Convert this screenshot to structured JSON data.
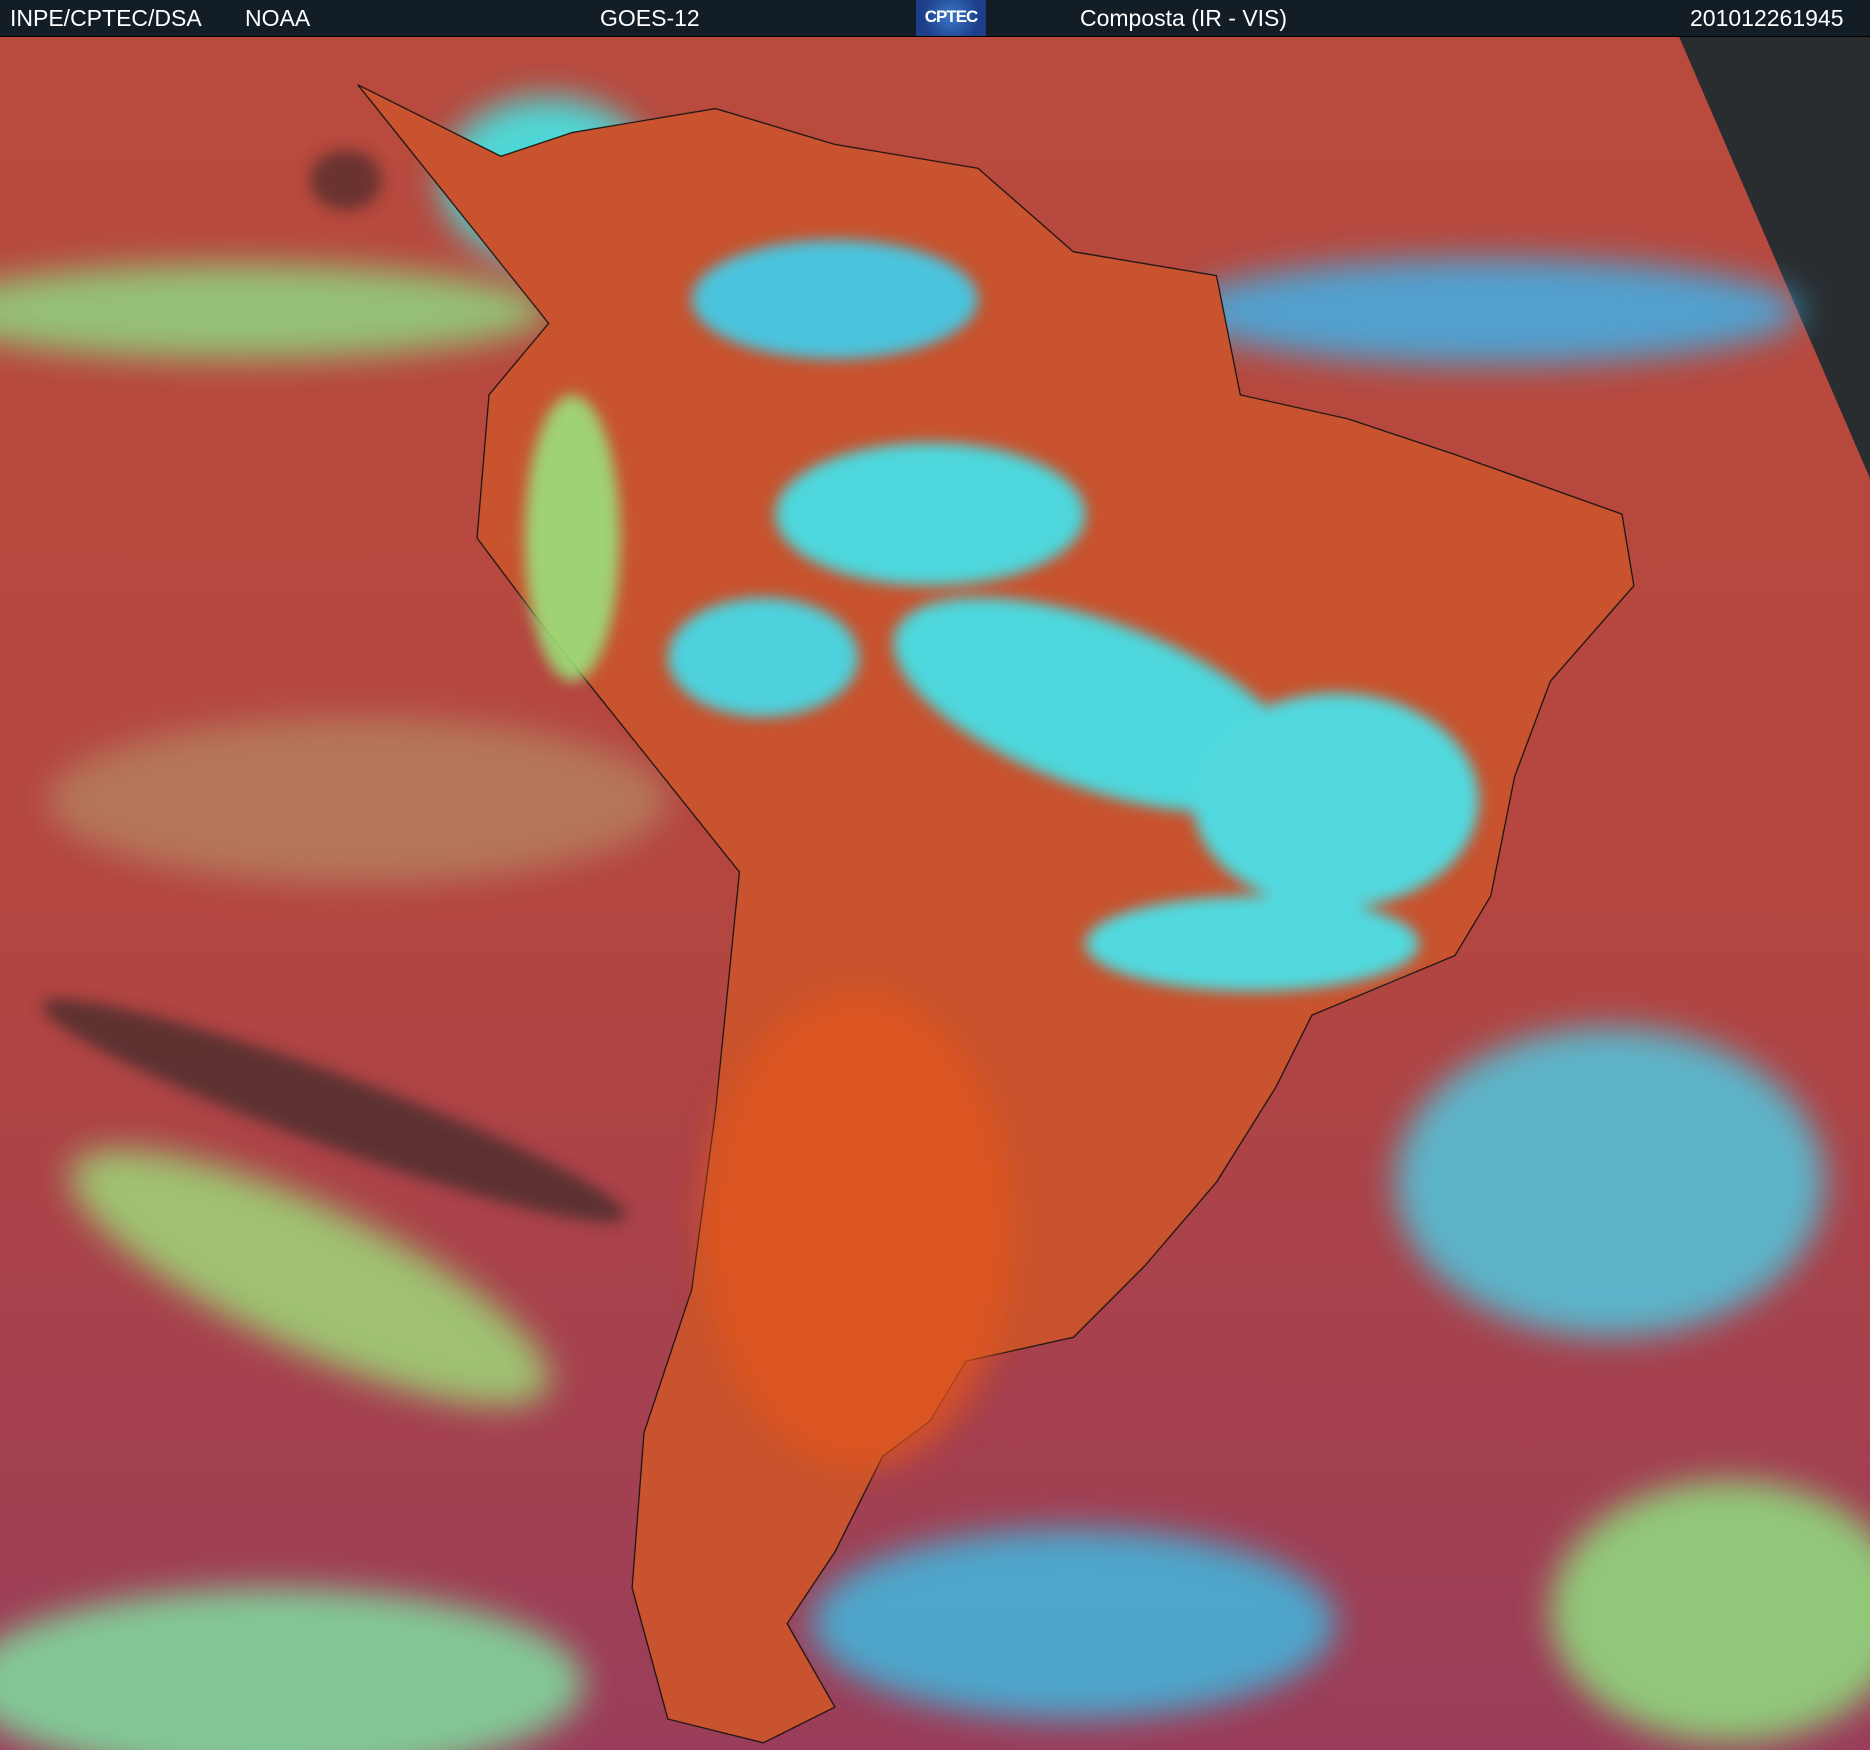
{
  "header": {
    "agency": "INPE/CPTEC/DSA",
    "provider": "NOAA",
    "satellite": "GOES-12",
    "logo_text": "CPTEC",
    "product": "Composta (IR - VIS)",
    "timestamp": "201012261945"
  },
  "colors": {
    "ocean": "#b0483f",
    "land": "#d4542a",
    "cloud_high": "#3ef0f0",
    "cloud_low": "#9be07a",
    "space": "#2a2d30"
  }
}
